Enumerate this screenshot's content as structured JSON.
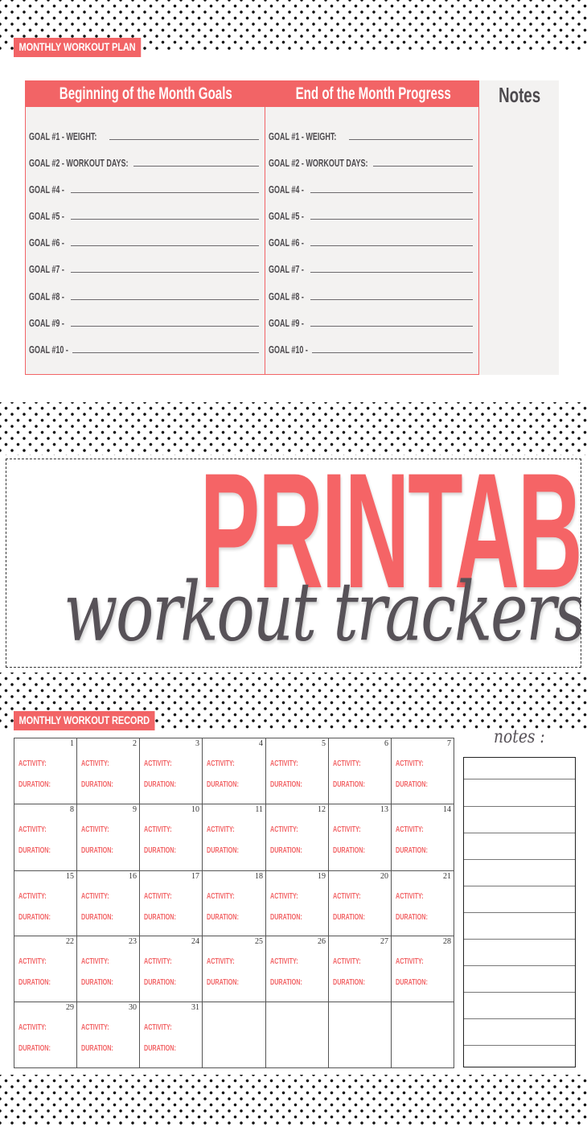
{
  "plan": {
    "tag": "Monthly Workout Plan",
    "columns": [
      {
        "header": "Beginning of the Month Goals",
        "goals": [
          "Goal #1 - Weight:",
          "Goal #2 - Workout Days:",
          "Goal #4 -",
          "Goal #5 -",
          "Goal #6 -",
          "Goal #7 -",
          "Goal #8 -",
          "Goal #9 -",
          "Goal #10 -"
        ]
      },
      {
        "header": "End of the Month Progress",
        "goals": [
          "Goal #1 - Weight:",
          "Goal #2 - Workout Days:",
          "Goal #4 -",
          "Goal #5 -",
          "Goal #6 -",
          "Goal #7 -",
          "Goal #8 -",
          "Goal #9 -",
          "Goal #10 -"
        ]
      }
    ],
    "notes_header": "Notes"
  },
  "banner": {
    "title": "PRINTABLE",
    "subtitle": "workout trackers"
  },
  "record": {
    "tag": "Monthly Workout Record",
    "activity_label": "ACTIVITY:",
    "duration_label": "DURATION:",
    "days": [
      "1",
      "2",
      "3",
      "4",
      "5",
      "6",
      "7",
      "8",
      "9",
      "10",
      "11",
      "12",
      "13",
      "14",
      "15",
      "16",
      "17",
      "18",
      "19",
      "20",
      "21",
      "22",
      "23",
      "24",
      "25",
      "26",
      "27",
      "28",
      "29",
      "30",
      "31"
    ],
    "notes_title": "notes :"
  },
  "colors": {
    "accent": "#f26466",
    "text_dark": "#4d4a4e",
    "panel_bg": "#f3f2f1"
  }
}
